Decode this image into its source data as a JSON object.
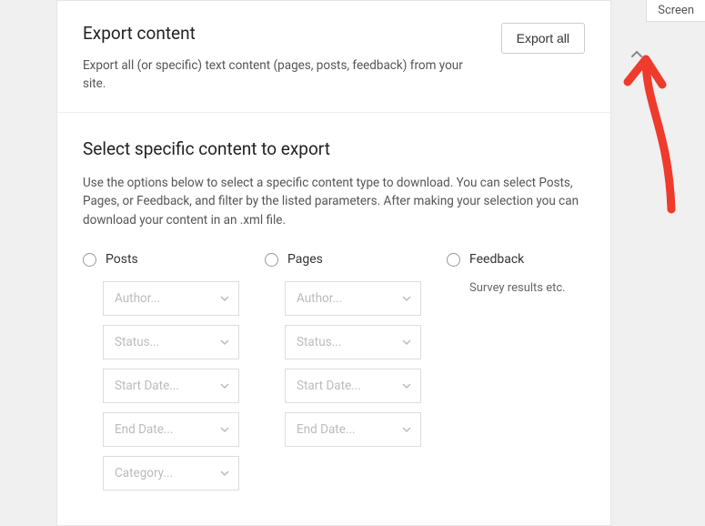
{
  "screen_tab": "Screen",
  "header": {
    "title": "Export content",
    "description": "Export all (or specific) text content (pages, posts, feedback) from your site.",
    "export_all_label": "Export all"
  },
  "body": {
    "title": "Select specific content to export",
    "description": "Use the options below to select a specific content type to download. You can select Posts, Pages, or Feedback, and filter by the listed parameters. After making your selection you can download your content in an .xml file."
  },
  "columns": {
    "posts": {
      "label": "Posts",
      "filters": {
        "author": "Author...",
        "status": "Status...",
        "start_date": "Start Date...",
        "end_date": "End Date...",
        "category": "Category..."
      }
    },
    "pages": {
      "label": "Pages",
      "filters": {
        "author": "Author...",
        "status": "Status...",
        "start_date": "Start Date...",
        "end_date": "End Date..."
      }
    },
    "feedback": {
      "label": "Feedback",
      "sub": "Survey results etc."
    }
  }
}
